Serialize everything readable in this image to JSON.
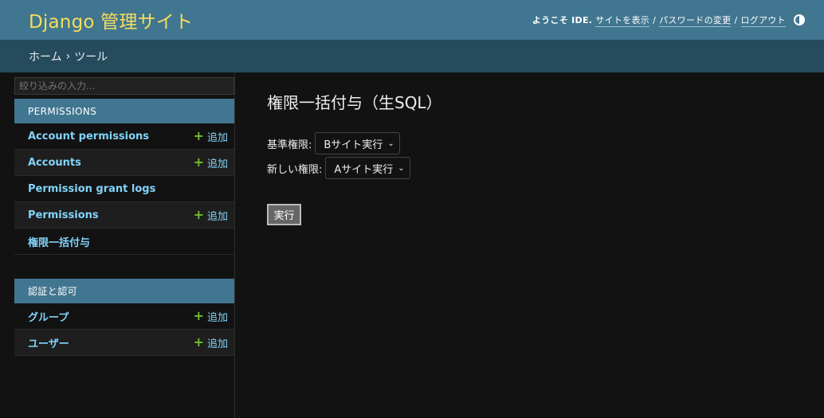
{
  "header": {
    "site_name": "Django 管理サイト",
    "welcome": "ようこそ IDE.",
    "view_site": "サイトを表示",
    "change_password": "パスワードの変更",
    "logout": "ログアウト",
    "separator": "/"
  },
  "breadcrumbs": {
    "home": "ホーム",
    "separator": "›",
    "current": "ツール"
  },
  "sidebar": {
    "filter_placeholder": "絞り込みの入力...",
    "add_label": "追加",
    "modules": [
      {
        "caption": "PERMISSIONS",
        "rows": [
          {
            "label": "Account permissions",
            "has_add": true
          },
          {
            "label": "Accounts",
            "has_add": true
          },
          {
            "label": "Permission grant logs",
            "has_add": false
          },
          {
            "label": "Permissions",
            "has_add": true
          },
          {
            "label": "権限一括付与",
            "has_add": false
          }
        ]
      },
      {
        "caption": "認証と認可",
        "rows": [
          {
            "label": "グループ",
            "has_add": true
          },
          {
            "label": "ユーザー",
            "has_add": true
          }
        ]
      }
    ]
  },
  "content": {
    "title": "権限一括付与（生SQL）",
    "fields": [
      {
        "label": "基準権限:",
        "value": "Bサイト実行"
      },
      {
        "label": "新しい権限:",
        "value": "Aサイト実行"
      }
    ],
    "submit_label": "実行"
  },
  "colors": {
    "header_bg": "#417690",
    "site_name": "#f5dd5d",
    "breadcrumb_bg": "#264b5d",
    "link": "#81d4fa",
    "add_plus": "#70bf2b"
  }
}
